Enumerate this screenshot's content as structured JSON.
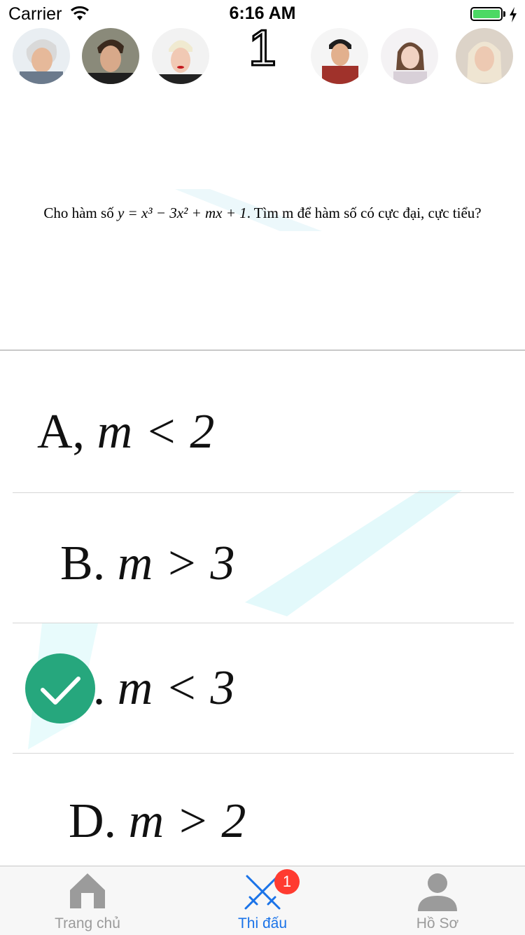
{
  "status_bar": {
    "carrier": "Carrier",
    "time": "6:16 AM",
    "battery_color": "#4cd964"
  },
  "match": {
    "round_number": "1",
    "left_players": [
      "player-1",
      "player-2",
      "player-3"
    ],
    "right_players": [
      "player-4",
      "player-5",
      "player-6"
    ]
  },
  "question": {
    "text_prefix": "Cho hàm số ",
    "formula": "y = x³ − 3x² + mx + 1",
    "text_suffix": ". Tìm m để hàm số có cực đại, cực tiểu?"
  },
  "answers": [
    {
      "letter": "A,",
      "formula": "m < 2",
      "selected": false
    },
    {
      "letter": "B.",
      "formula": "m > 3",
      "selected": false
    },
    {
      "letter": "C.",
      "formula": "m < 3",
      "selected": true
    },
    {
      "letter": "D.",
      "formula": "m > 2",
      "selected": false
    }
  ],
  "tab_bar": {
    "active_color": "#1a73e8",
    "inactive_color": "#9b9b9b",
    "items": [
      {
        "label": "Trang chủ",
        "icon": "home-icon"
      },
      {
        "label": "Thi đấu",
        "icon": "crossed-swords-icon",
        "badge": "1"
      },
      {
        "label": "Hồ Sơ",
        "icon": "person-icon"
      }
    ]
  }
}
